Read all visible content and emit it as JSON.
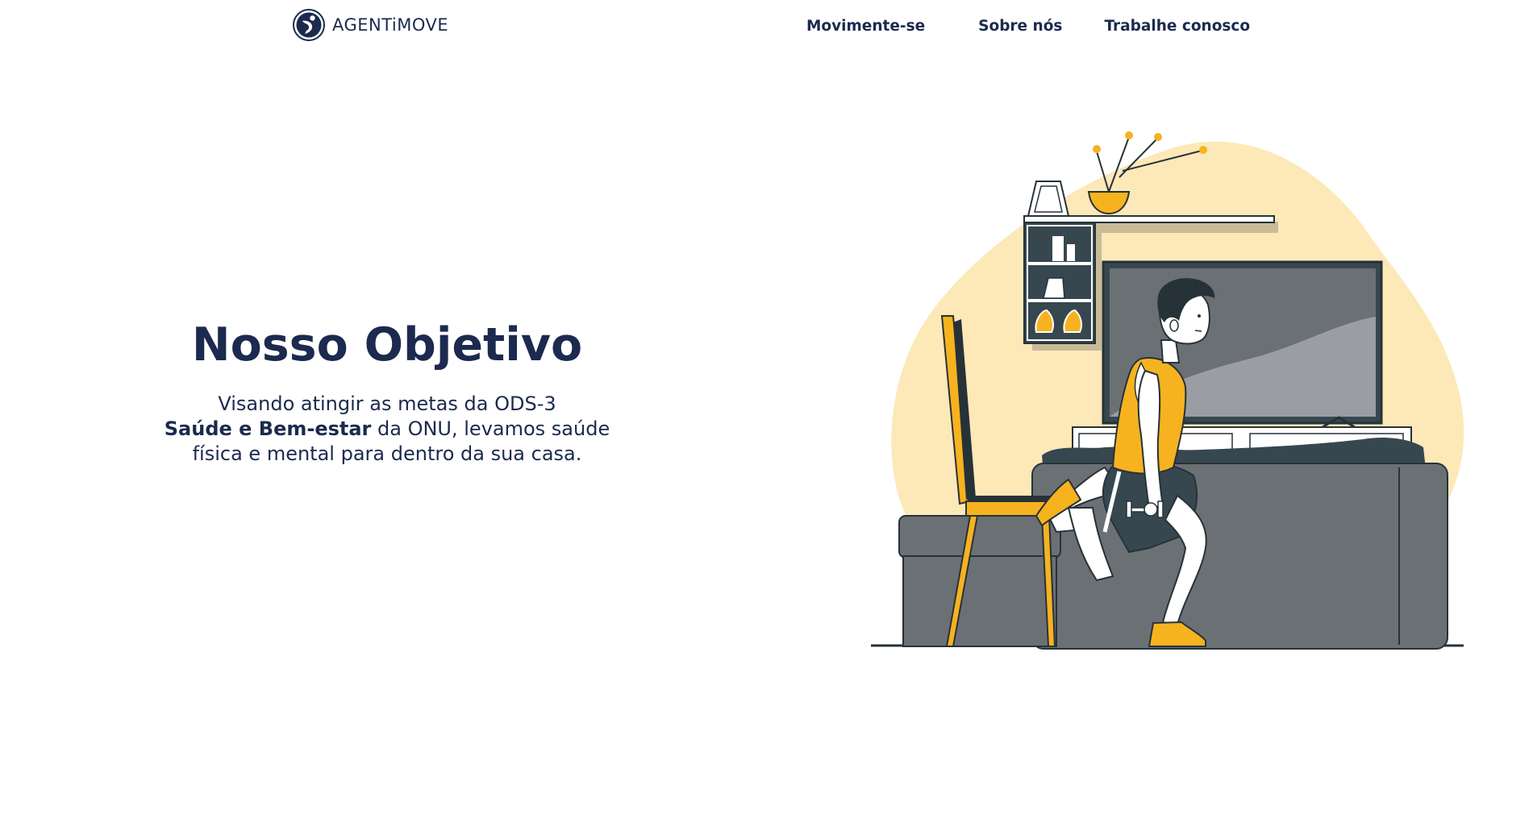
{
  "header": {
    "logo_text": "AGENTiMOVE",
    "nav": [
      {
        "label": "Movimente-se"
      },
      {
        "label": "Sobre nós"
      },
      {
        "label": "Trabalhe conosco"
      }
    ]
  },
  "hero": {
    "title": "Nosso Objetivo",
    "subtitle_line1": "Visando atingir as metas da ODS-3",
    "subtitle_bold": "Saúde e Bem-estar",
    "subtitle_line2_rest": " da ONU, levamos saúde",
    "subtitle_line3": "física e mental para dentro da sua casa."
  },
  "colors": {
    "navy": "#1b2a4e",
    "accent_yellow": "#f7b21f",
    "blob_cream": "#fde8b8",
    "sofa_gray": "#6b7075",
    "dark": "#263238"
  },
  "icons": {
    "logo": "agentimove-logo-icon"
  }
}
